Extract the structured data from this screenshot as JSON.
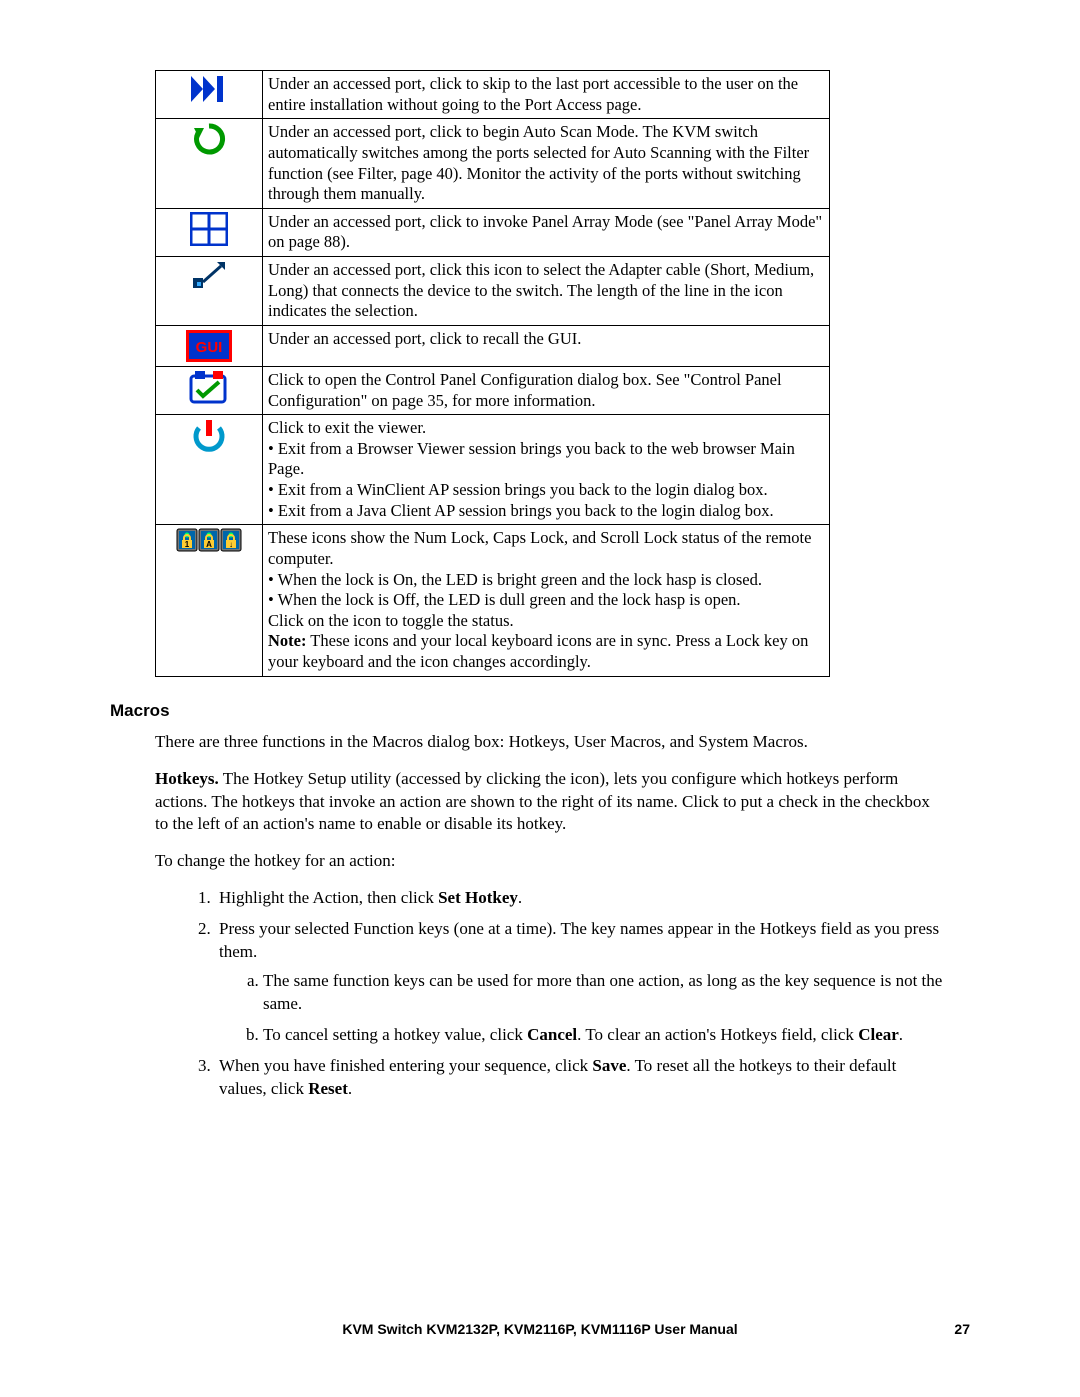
{
  "table_rows": [
    {
      "icon": "skip-last",
      "text": "Under an accessed port, click to skip to the last port accessible to the user on the entire installation without going to the Port Access page."
    },
    {
      "icon": "auto-scan",
      "text": "Under an accessed port, click to begin Auto Scan Mode. The KVM switch automatically switches among the ports selected for Auto Scanning with the Filter function (see Filter, page 40). Monitor the activity of the ports without switching through them manually."
    },
    {
      "icon": "panel-array",
      "text": "Under an accessed port, click to invoke Panel Array Mode (see \"Panel Array Mode\" on page 88)."
    },
    {
      "icon": "adapter",
      "text": "Under an accessed port, click this icon to select the Adapter cable (Short, Medium, Long) that connects the device to the switch. The length of the line in the icon indicates the selection."
    },
    {
      "icon": "gui",
      "text": "Under an accessed port, click to recall the GUI."
    },
    {
      "icon": "config",
      "text": "Click to open the Control Panel Configuration dialog box. See \"Control Panel Configuration\" on page 35, for more information."
    },
    {
      "icon": "exit",
      "text": "Click to exit the viewer.\n• Exit from a Browser Viewer session brings you back to the web browser Main Page.\n• Exit from a WinClient AP session brings you back to the login dialog box.\n• Exit from a Java Client AP session brings you back to the login dialog box."
    },
    {
      "icon": "locks",
      "text_parts": {
        "pre": "These icons show the Num Lock, Caps Lock, and Scroll Lock status of the remote computer.\n• When the lock is On, the LED is bright green and the lock hasp is closed.\n• When the lock is Off, the LED is dull green and the lock hasp is open.\nClick on the icon to toggle the status.\n",
        "note_label": "Note:",
        "note_rest": " These icons and your local keyboard icons are in sync. Press a Lock key on your keyboard and the icon changes accordingly."
      }
    }
  ],
  "macros_heading": "Macros",
  "macros_intro": "There are three functions in the Macros dialog box: Hotkeys, User Macros, and System Macros.",
  "hotkeys_label": "Hotkeys.",
  "hotkeys_text": " The Hotkey Setup utility (accessed by clicking the icon), lets you configure which hotkeys perform actions. The hotkeys that invoke an action are shown to the right of its name. Click to put a check in the checkbox to the left of an action's name to enable or disable its hotkey.",
  "change_intro": "To change the hotkey for an action:",
  "step1_pre": "Highlight the Action, then click ",
  "step1_bold": "Set Hotkey",
  "step1_post": ".",
  "step2": "Press your selected Function keys (one at a time). The key names appear in the Hotkeys field as you press them.",
  "step2a": "The same function keys can be used for more than one action, as long as the key sequence is not the same.",
  "step2b_pre": "To cancel setting a hotkey value, click ",
  "step2b_bold1": "Cancel",
  "step2b_mid": ". To clear an action's Hotkeys field, click ",
  "step2b_bold2": "Clear",
  "step2b_post": ".",
  "step3_pre": "When you have finished entering your sequence, click ",
  "step3_bold1": "Save",
  "step3_mid": ". To reset all the hotkeys to their default values, click ",
  "step3_bold2": "Reset",
  "step3_post": ".",
  "footer_title": "KVM Switch KVM2132P, KVM2116P, KVM1116P User Manual",
  "page_number": "27"
}
